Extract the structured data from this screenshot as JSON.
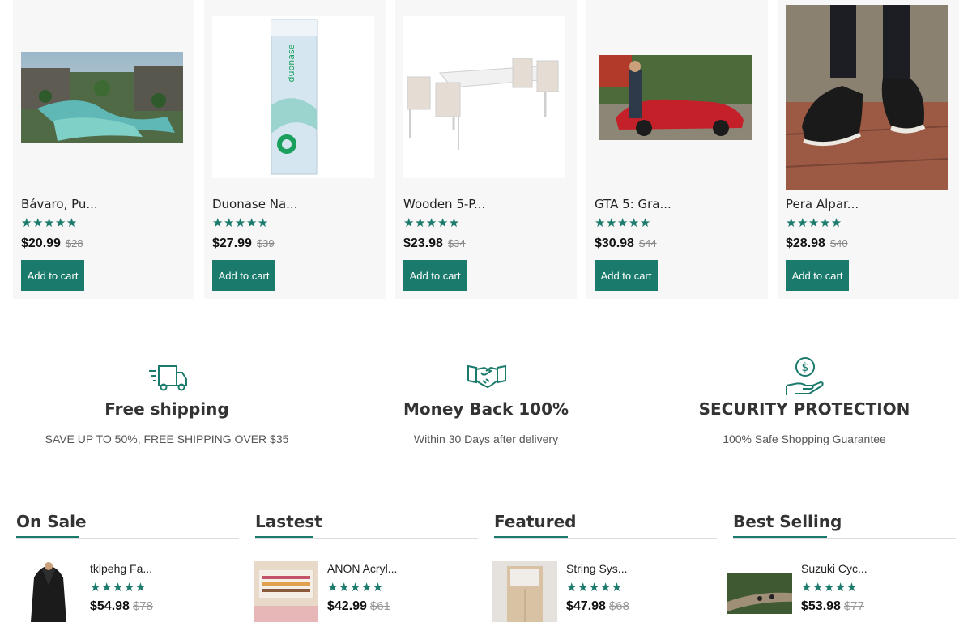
{
  "accent_color": "#1a7a6b",
  "products": [
    {
      "name": "Bávaro, Pu...",
      "rating": 5,
      "price": "$20.99",
      "old_price": "$28",
      "cart_label": "Add to cart",
      "image": "resort-pool-photo"
    },
    {
      "name": "Duonase Na...",
      "rating": 5,
      "price": "$27.99",
      "old_price": "$39",
      "cart_label": "Add to cart",
      "image": "nasal-spray-box"
    },
    {
      "name": "Wooden 5-P...",
      "rating": 5,
      "price": "$23.98",
      "old_price": "$34",
      "cart_label": "Add to cart",
      "image": "dining-table-set"
    },
    {
      "name": "GTA 5: Gra...",
      "rating": 5,
      "price": "$30.98",
      "old_price": "$44",
      "cart_label": "Add to cart",
      "image": "red-sports-car"
    },
    {
      "name": "Pera Alpar...",
      "rating": 5,
      "price": "$28.98",
      "old_price": "$40",
      "cart_label": "Add to cart",
      "image": "black-slip-on-shoes"
    }
  ],
  "features": [
    {
      "icon": "delivery-truck-icon",
      "title": "Free shipping",
      "subtitle": "SAVE UP TO 50%, FREE SHIPPING OVER $35"
    },
    {
      "icon": "handshake-icon",
      "title": "Money Back 100%",
      "subtitle": "Within 30 Days after delivery"
    },
    {
      "icon": "dollar-hand-icon",
      "title": "SECURITY PROTECTION",
      "subtitle": "100% Safe Shopping Guarantee"
    }
  ],
  "lists": [
    {
      "title": "On Sale",
      "item": {
        "name": "tklpehg Fa...",
        "rating": 5,
        "price": "$54.98",
        "old_price": "$78",
        "image": "leather-jacket"
      }
    },
    {
      "title": "Lastest",
      "item": {
        "name": "ANON Acryl...",
        "rating": 5,
        "price": "$42.99",
        "old_price": "$61",
        "image": "acrylic-drawer"
      }
    },
    {
      "title": "Featured",
      "item": {
        "name": "String Sys...",
        "rating": 5,
        "price": "$47.98",
        "old_price": "$68",
        "image": "wooden-cabinet"
      }
    },
    {
      "title": "Best Selling",
      "item": {
        "name": "Suzuki Cyc...",
        "rating": 5,
        "price": "$53.98",
        "old_price": "$77",
        "image": "motorbike-trail"
      }
    }
  ],
  "stars_text": "★★★★★"
}
